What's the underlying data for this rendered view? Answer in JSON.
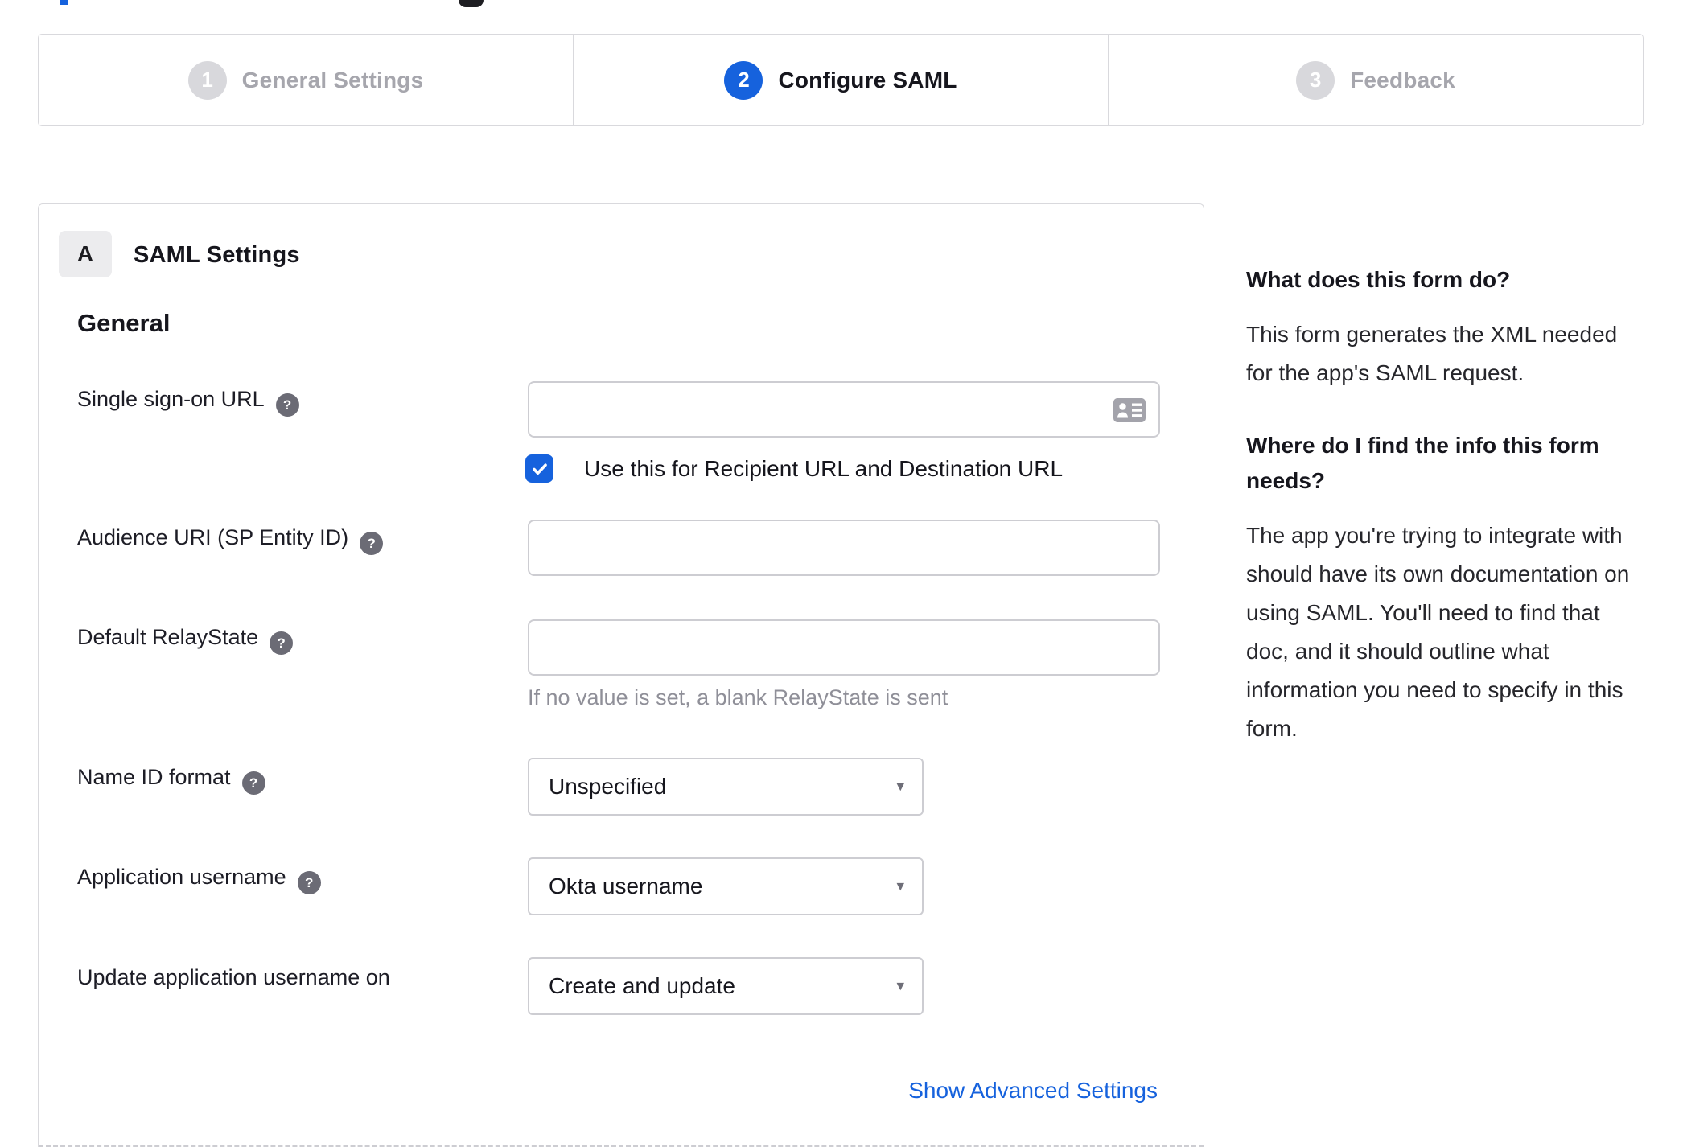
{
  "colors": {
    "accent_blue": "#1662dd",
    "inactive_gray": "#d8d8dc",
    "border_gray": "#d9d9dd"
  },
  "stepper": {
    "steps": [
      {
        "number": "1",
        "label": "General Settings",
        "state": "inactive"
      },
      {
        "number": "2",
        "label": "Configure SAML",
        "state": "active"
      },
      {
        "number": "3",
        "label": "Feedback",
        "state": "inactive"
      }
    ]
  },
  "panel": {
    "section_badge": "A",
    "section_title": "SAML Settings",
    "group_heading": "General",
    "fields": {
      "sso_url": {
        "label": "Single sign-on URL",
        "value": "",
        "checkbox_label": "Use this for Recipient URL and Destination URL",
        "checkbox_checked": true
      },
      "audience_uri": {
        "label": "Audience URI (SP Entity ID)",
        "value": ""
      },
      "default_relay_state": {
        "label": "Default RelayState",
        "value": "",
        "hint": "If no value is set, a blank RelayState is sent"
      },
      "name_id_format": {
        "label": "Name ID format",
        "value": "Unspecified"
      },
      "application_username": {
        "label": "Application username",
        "value": "Okta username"
      },
      "update_application_username_on": {
        "label": "Update application username on",
        "value": "Create and update"
      }
    },
    "advanced_link": "Show Advanced Settings"
  },
  "sidebar": {
    "blocks": [
      {
        "heading": "What does this form do?",
        "body": "This form generates the XML needed for the app's SAML request."
      },
      {
        "heading": "Where do I find the info this form needs?",
        "body": "The app you're trying to integrate with should have its own documentation on using SAML. You'll need to find that doc, and it should outline what information you need to specify in this form."
      }
    ]
  },
  "icons": {
    "help_glyph": "?",
    "select_caret_glyph": "▾"
  }
}
